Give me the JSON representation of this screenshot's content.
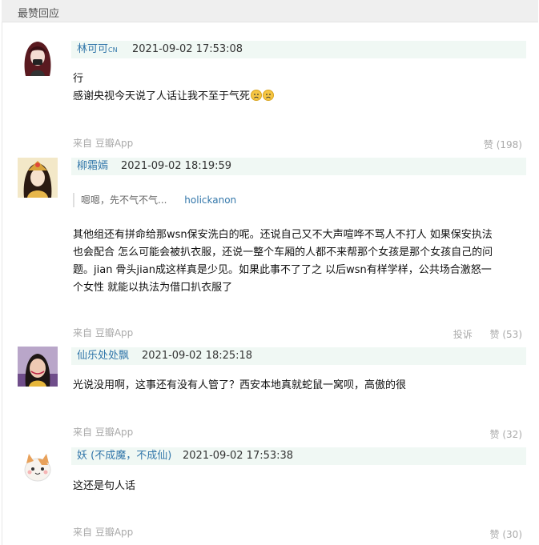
{
  "section_title": "最赞回应",
  "comments": [
    {
      "user": "林可可",
      "user_badge": "CN",
      "time": "2021-09-02 17:53:08",
      "lines": [
        "行",
        "感谢央视今天说了人话让我不至于气死"
      ],
      "emoji_count": 2,
      "source": "来自 豆瓣App",
      "likes": "赞 (198)"
    },
    {
      "user": "柳霜嫣",
      "time": "2021-09-02 18:19:59",
      "quote_text": "嗯嗯，先不气不气...",
      "quote_author": "holickanon",
      "lines": [
        "其他组还有拼命给那wsn保安洗白的呢。还说自己又不大声喧哗不骂人不打人 如果保安执法",
        "也会配合 怎么可能会被扒衣服，还说一整个车厢的人都不来帮那个女孩是那个女孩自己的问",
        "题。jian 骨头jian成这样真是少见。如果此事不了了之 以后wsn有样学样，公共场合激怒一",
        "个女性 就能以执法为借口扒衣服了"
      ],
      "source": "来自 豆瓣App",
      "report": "投诉",
      "likes": "赞 (53)"
    },
    {
      "user": "仙乐处处飘",
      "time": "2021-09-02 18:25:18",
      "lines": [
        "光说没用啊，这事还有没有人管了？西安本地真就蛇鼠一窝呗，高傲的很"
      ],
      "source": "来自 豆瓣App",
      "likes": "赞 (32)"
    },
    {
      "user": "妖 (不成魔，不成仙)",
      "time": "2021-09-02 17:53:38",
      "lines": [
        "这还是句人话"
      ],
      "source": "来自 豆瓣App",
      "likes": "赞 (30)"
    }
  ],
  "colors": {
    "username": "#3377aa",
    "meta_bg": "#f0f8f4",
    "muted": "#aaaaaa"
  }
}
